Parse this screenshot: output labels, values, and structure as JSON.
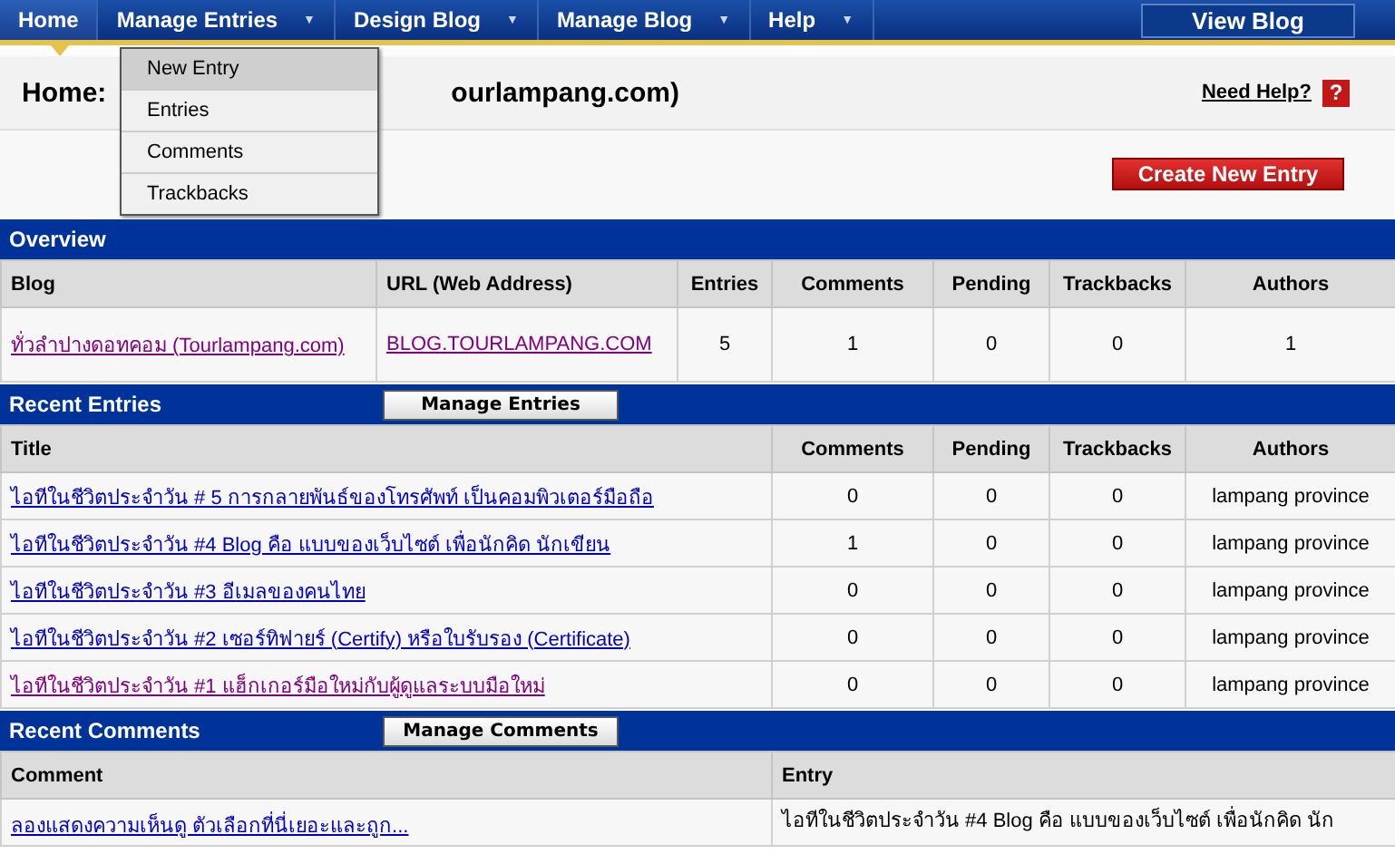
{
  "nav": {
    "items": [
      {
        "label": "Home",
        "selected": true,
        "dropdown": false
      },
      {
        "label": "Manage Entries",
        "selected": false,
        "dropdown": true
      },
      {
        "label": "Design Blog",
        "selected": false,
        "dropdown": true
      },
      {
        "label": "Manage Blog",
        "selected": false,
        "dropdown": true
      },
      {
        "label": "Help",
        "selected": false,
        "dropdown": true
      }
    ],
    "arrow": "▼",
    "view_button": "View Blog"
  },
  "menu": {
    "items": [
      {
        "label": "New Entry",
        "selected": true
      },
      {
        "label": "Entries",
        "selected": false
      },
      {
        "label": "Comments",
        "selected": false
      },
      {
        "label": "Trackbacks",
        "selected": false
      }
    ]
  },
  "page_header": {
    "title_start": "Home:",
    "title_end": "ourlampang.com)",
    "help_link": "Need Help?",
    "help_icon": "?"
  },
  "create_button": "Create New Entry",
  "overview": {
    "title": "Overview",
    "columns": [
      "Blog",
      "URL (Web Address)",
      "Entries",
      "Comments",
      "Pending",
      "Trackbacks",
      "Authors"
    ],
    "row": {
      "blog": "ทั่วลำปางดอทคอม (Tourlampang.com)",
      "url": "BLOG.TOURLAMPANG.COM",
      "visited": true,
      "entries": "5",
      "comments": "1",
      "pending": "0",
      "trackbacks": "0",
      "authors": "1"
    }
  },
  "recent_entries": {
    "title": "Recent Entries",
    "button": "Manage Entries",
    "columns": [
      "Title",
      "Comments",
      "Pending",
      "Trackbacks",
      "Authors"
    ],
    "rows": [
      {
        "title": "ไอทีในชีวิตประจำวัน # 5 การกลายพันธ์ของโทรศัพท์ เป็นคอมพิวเตอร์มือถือ",
        "visited": false,
        "comments": "0",
        "pending": "0",
        "trackbacks": "0",
        "author": "lampang province"
      },
      {
        "title": "ไอทีในชีวิตประจำวัน #4 Blog คือ แบบของเว็บไซต์ เพื่อนักคิด นักเขียน",
        "visited": false,
        "comments": "1",
        "pending": "0",
        "trackbacks": "0",
        "author": "lampang province"
      },
      {
        "title": "ไอทีในชีวิตประจำวัน #3 อีเมลของคนไทย",
        "visited": false,
        "comments": "0",
        "pending": "0",
        "trackbacks": "0",
        "author": "lampang province"
      },
      {
        "title": "ไอทีในชีวิตประจำวัน #2 เซอร์ทิฟายร์ (Certify) หรือใบรับรอง (Certificate)",
        "visited": false,
        "comments": "0",
        "pending": "0",
        "trackbacks": "0",
        "author": "lampang province"
      },
      {
        "title": "ไอทีในชีวิตประจำวัน #1 แฮ็กเกอร์มือใหม่กับผู้ดูแลระบบมือใหม่",
        "visited": true,
        "comments": "0",
        "pending": "0",
        "trackbacks": "0",
        "author": "lampang province"
      }
    ]
  },
  "recent_comments": {
    "title": "Recent Comments",
    "button": "Manage Comments",
    "columns": [
      "Comment",
      "Entry"
    ],
    "rows": [
      {
        "comment": "ลองแสดงความเห็นดู ตัวเลือกที่นี่เยอะและถูก...",
        "entry": "ไอทีในชีวิตประจำวัน #4 Blog คือ แบบของเว็บไซต์ เพื่อนักคิด นัก"
      }
    ]
  }
}
